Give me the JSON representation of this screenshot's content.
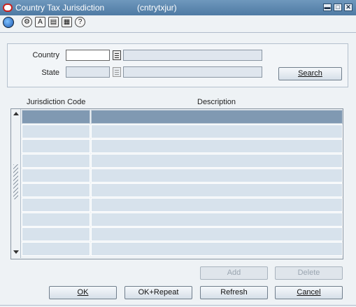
{
  "window": {
    "title": "Country Tax Jurisdiction",
    "form_name": "(cntrytxjur)",
    "controls": {
      "minimize": "▬",
      "maximize": "□",
      "close": "✕"
    }
  },
  "toolbar": {
    "icons": [
      "globe-icon",
      "help-search-icon",
      "spell-check-icon",
      "notes-icon",
      "print-icon",
      "help-icon"
    ],
    "glyphs": {
      "help-search": "⚙",
      "spell-check": "A",
      "notes": "▤",
      "print": "▦",
      "help": "?"
    }
  },
  "search": {
    "country_label": "Country",
    "state_label": "State",
    "country_value": "",
    "country_desc": "",
    "state_value": "",
    "state_desc": "",
    "search_button": "Search"
  },
  "grid": {
    "headers": [
      "Jurisdiction Code",
      "Description"
    ],
    "rows": [
      [
        "",
        ""
      ],
      [
        "",
        ""
      ],
      [
        "",
        ""
      ],
      [
        "",
        ""
      ],
      [
        "",
        ""
      ],
      [
        "",
        ""
      ],
      [
        "",
        ""
      ],
      [
        "",
        ""
      ],
      [
        "",
        ""
      ],
      [
        "",
        ""
      ]
    ]
  },
  "buttons": {
    "add": "Add",
    "delete": "Delete",
    "ok": "OK",
    "ok_repeat": "OK+Repeat",
    "refresh": "Refresh",
    "cancel": "Cancel"
  },
  "colors": {
    "titlebar": "#5a85ad",
    "selected_row": "#8099b2",
    "row": "#d7e2ec"
  }
}
